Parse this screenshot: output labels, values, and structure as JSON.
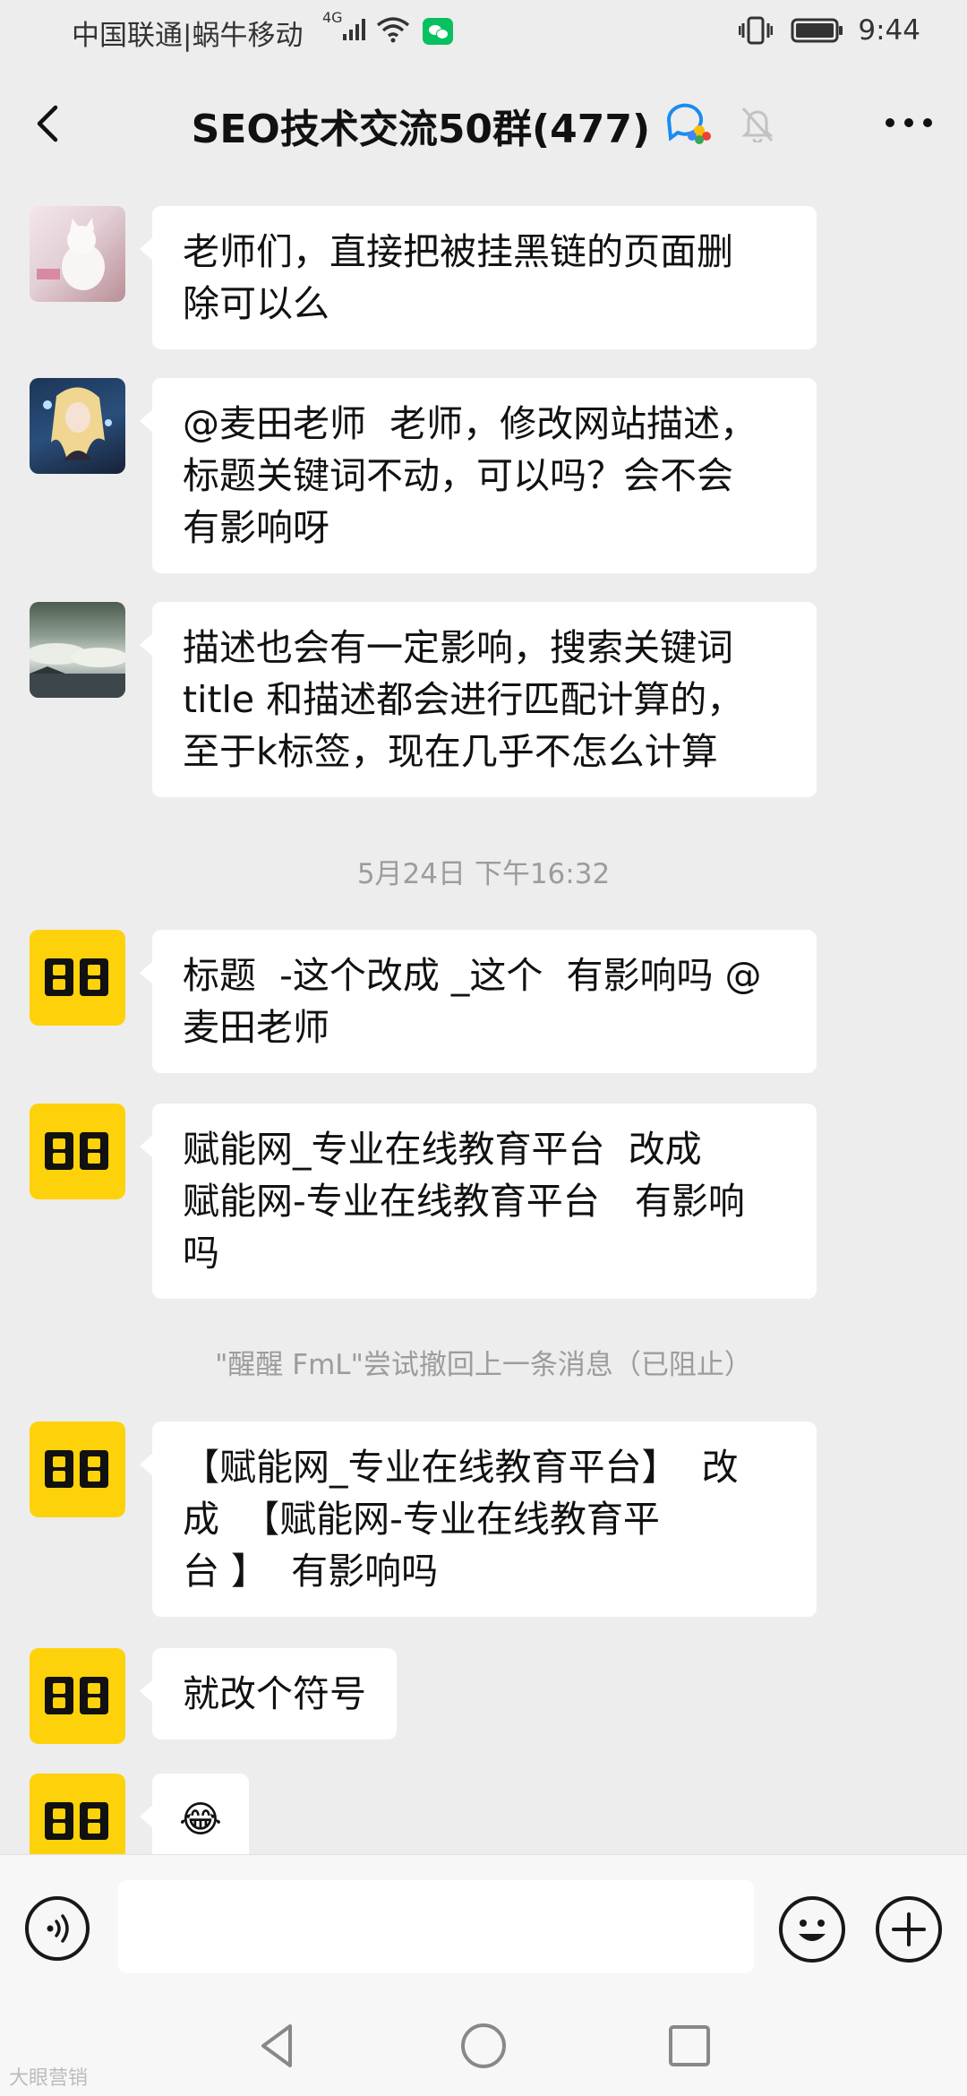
{
  "status_bar": {
    "carrier": "中国联通|蜗牛移动",
    "network": "4G",
    "time": "9:44"
  },
  "header": {
    "title": "SEO技术交流50群(477)"
  },
  "messages": [
    {
      "type": "message",
      "avatar": "cat-photo",
      "text": "老师们，直接把被挂黑链的页面删\n除可以么"
    },
    {
      "type": "message",
      "avatar": "anime-girl",
      "text": "@麦田老师  老师，修改网站描述，\n标题关键词不动，可以吗？会不会\n有影响呀"
    },
    {
      "type": "message",
      "avatar": "clouds-landscape",
      "text": "描述也会有一定影响，搜索关键词\ntitle 和描述都会进行匹配计算的，\n至于k标签，现在几乎不怎么计算"
    },
    {
      "type": "timestamp",
      "text": "5月24日 下午16:32"
    },
    {
      "type": "message",
      "avatar": "yellow-logo",
      "text": "标题  -这个改成 _这个  有影响吗 @\n麦田老师"
    },
    {
      "type": "message",
      "avatar": "yellow-logo",
      "text": "赋能网_专业在线教育平台  改成\n赋能网-专业在线教育平台   有影响\n吗"
    },
    {
      "type": "system",
      "text": "\"醒醒 FmL\"尝试撤回上一条消息（已阻止）"
    },
    {
      "type": "message",
      "avatar": "yellow-logo",
      "text": "【赋能网_专业在线教育平台】  改\n成  【赋能网-专业在线教育平\n台 】  有影响吗"
    },
    {
      "type": "message",
      "avatar": "yellow-logo",
      "text": "就改个符号"
    },
    {
      "type": "message",
      "avatar": "yellow-logo",
      "text": "😂"
    }
  ],
  "input": {
    "placeholder": ""
  },
  "icons": {
    "back": "chevron-left-icon",
    "group": "group-chat-icon",
    "mute": "bell-muted-icon",
    "more": "more-dots-icon",
    "voice": "voice-icon",
    "emoji": "emoji-icon",
    "plus": "plus-icon"
  },
  "colors": {
    "background": "#ededed",
    "bubble": "#ffffff",
    "yellow_avatar": "#fed20a",
    "wechat_green": "#07c160"
  },
  "watermark": "大眼营销"
}
